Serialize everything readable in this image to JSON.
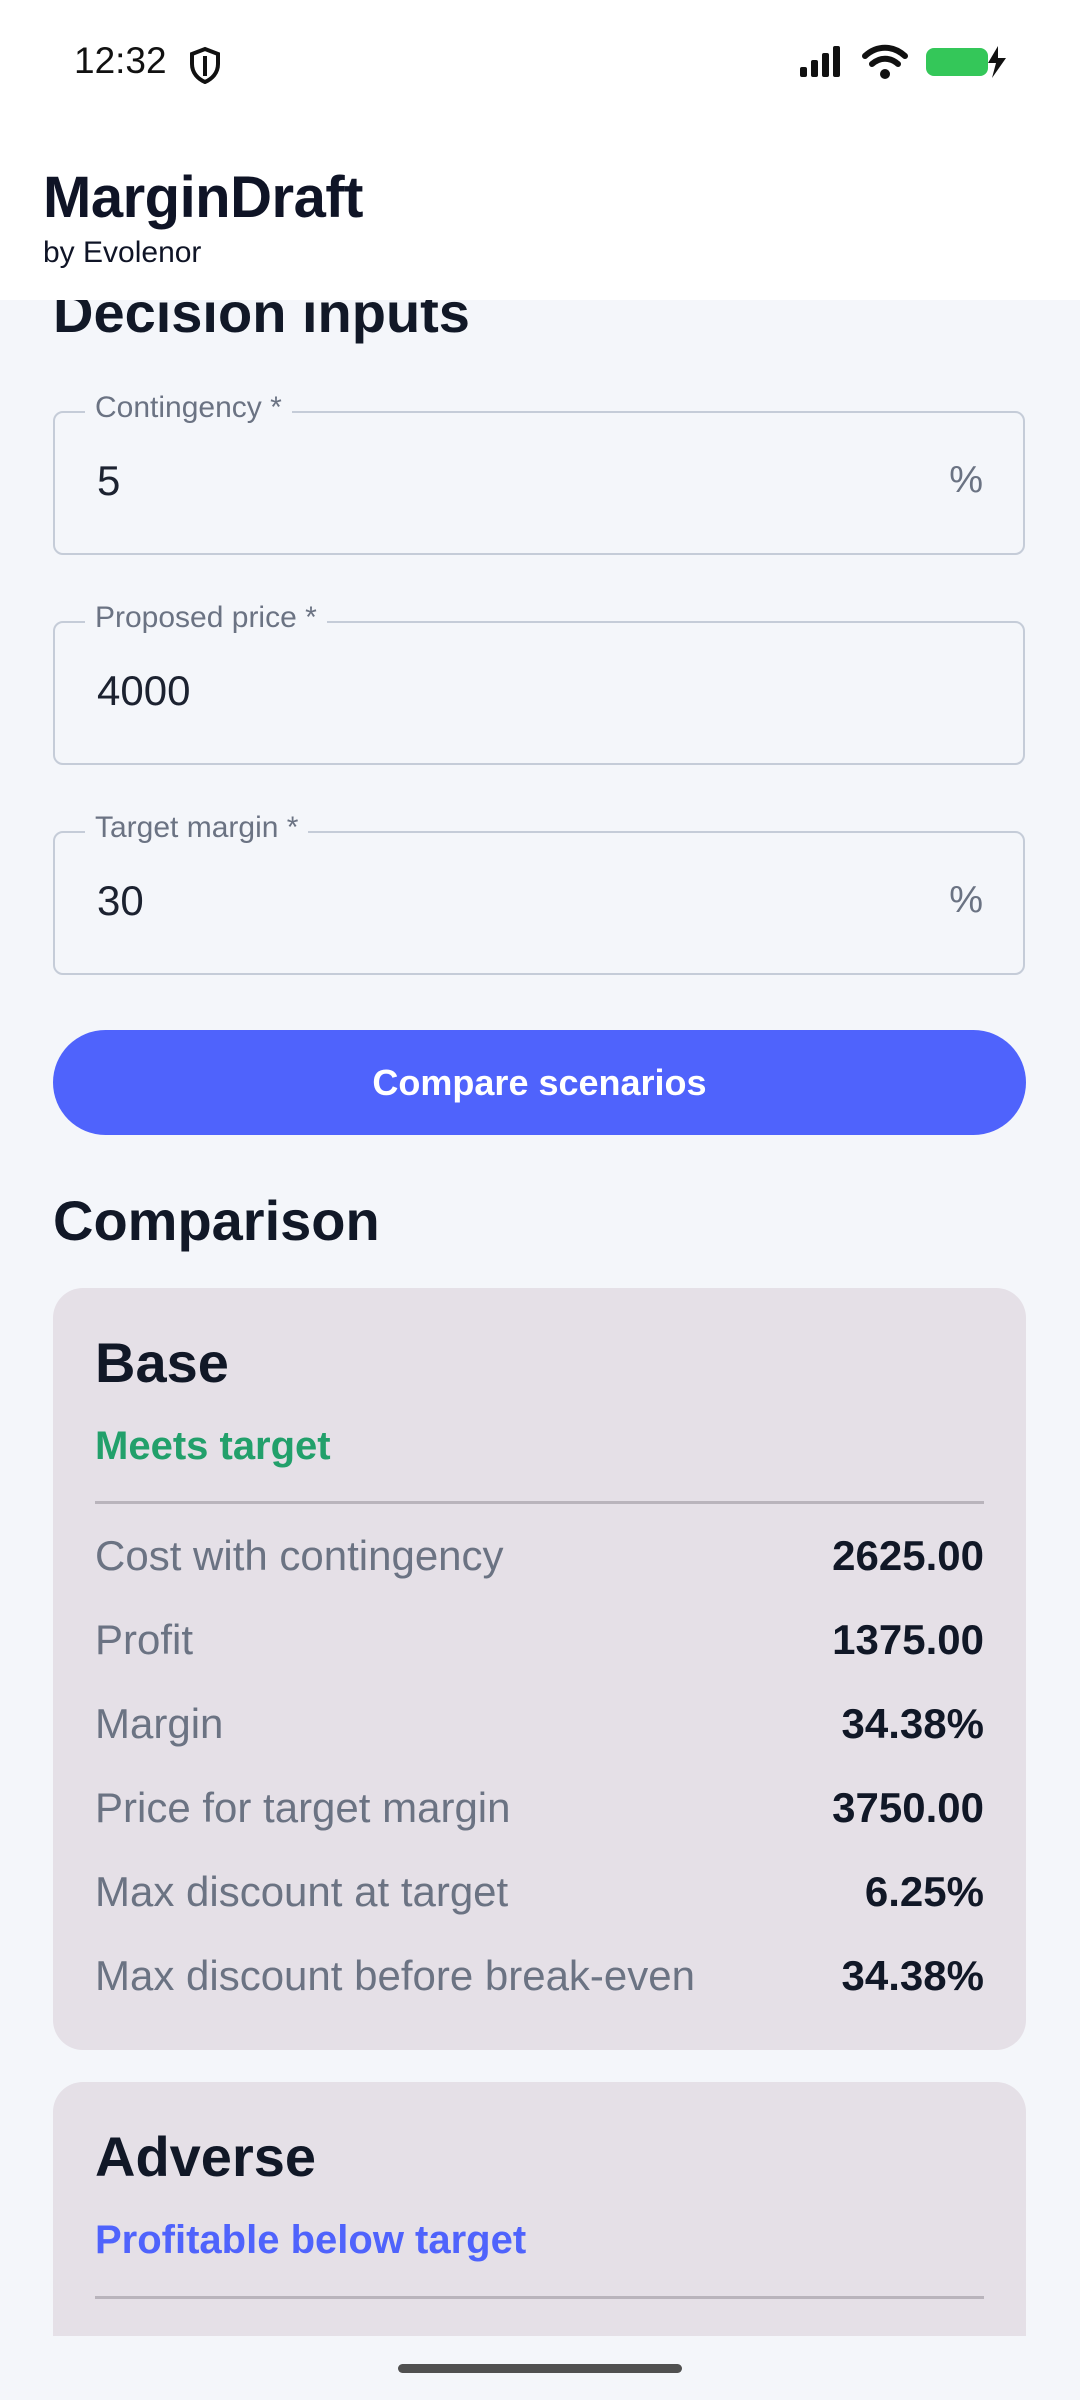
{
  "status_bar": {
    "time": "12:32"
  },
  "app": {
    "title": "MarginDraft",
    "subtitle": "by Evolenor"
  },
  "inputs": {
    "section_title": "Decision inputs",
    "contingency": {
      "label": "Contingency *",
      "value": "5",
      "suffix": "%"
    },
    "proposed_price": {
      "label": "Proposed price *",
      "value": "4000"
    },
    "target_margin": {
      "label": "Target margin *",
      "value": "30",
      "suffix": "%"
    },
    "compare_button": "Compare scenarios"
  },
  "comparison": {
    "title": "Comparison",
    "cards": [
      {
        "title": "Base",
        "status": "Meets target",
        "status_color": "#22a06b",
        "metrics": [
          {
            "label": "Cost with contingency",
            "value": "2625.00"
          },
          {
            "label": "Profit",
            "value": "1375.00"
          },
          {
            "label": "Margin",
            "value": "34.38%"
          },
          {
            "label": "Price for target margin",
            "value": "3750.00"
          },
          {
            "label": "Max discount at target",
            "value": "6.25%"
          },
          {
            "label": "Max discount before break-even",
            "value": "34.38%"
          }
        ]
      },
      {
        "title": "Adverse",
        "status": "Profitable below target",
        "status_color": "#4f63fc"
      }
    ]
  },
  "colors": {
    "accent": "#4f63fc",
    "card_bg": "#e5e0e7",
    "battery": "#34c759"
  }
}
